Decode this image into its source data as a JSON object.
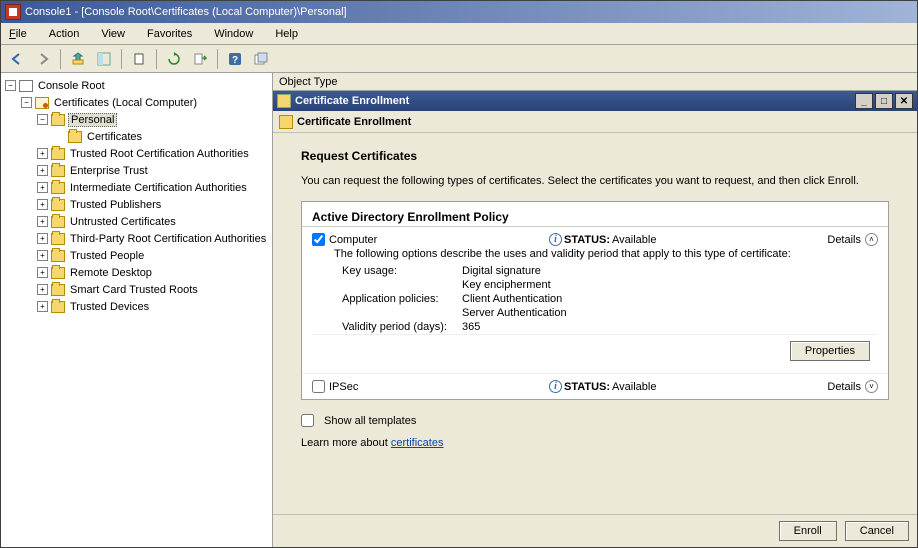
{
  "window": {
    "title": "Console1 - [Console Root\\Certificates (Local Computer)\\Personal]"
  },
  "menu": {
    "file": "File",
    "action": "Action",
    "view": "View",
    "favorites": "Favorites",
    "window": "Window",
    "help": "Help"
  },
  "tree": {
    "root": "Console Root",
    "certs": "Certificates (Local Computer)",
    "personal": "Personal",
    "certificates": "Certificates",
    "trusted_root": "Trusted Root Certification Authorities",
    "enterprise_trust": "Enterprise Trust",
    "intermediate": "Intermediate Certification Authorities",
    "trusted_pub": "Trusted Publishers",
    "untrusted": "Untrusted Certificates",
    "third_party": "Third-Party Root Certification Authorities",
    "trusted_people": "Trusted People",
    "remote_desktop": "Remote Desktop",
    "smart_card": "Smart Card Trusted Roots",
    "trusted_devices": "Trusted Devices"
  },
  "right": {
    "object_type": "Object Type",
    "panel_title": "Certificate Enrollment",
    "panel_sub": "Certificate Enrollment",
    "heading": "Request Certificates",
    "desc": "You can request the following types of certificates. Select the certificates you want to request, and then click Enroll.",
    "policy_title": "Active Directory Enrollment Policy",
    "templates": [
      {
        "name": "Computer",
        "checked": true,
        "status_label": "STATUS:",
        "status_value": "Available",
        "details": "Details",
        "expanded": true,
        "desc": "The following options describe the uses and validity period that apply to this type of certificate:",
        "key_usage_label": "Key usage:",
        "key_usage_1": "Digital signature",
        "key_usage_2": "Key encipherment",
        "app_pol_label": "Application policies:",
        "app_pol_1": "Client Authentication",
        "app_pol_2": "Server Authentication",
        "validity_label": "Validity period (days):",
        "validity_value": "365",
        "properties": "Properties"
      },
      {
        "name": "IPSec",
        "checked": false,
        "status_label": "STATUS:",
        "status_value": "Available",
        "details": "Details",
        "expanded": false
      }
    ],
    "show_all": "Show all templates",
    "learn_prefix": "Learn more about ",
    "learn_link": "certificates",
    "enroll": "Enroll",
    "cancel": "Cancel"
  }
}
